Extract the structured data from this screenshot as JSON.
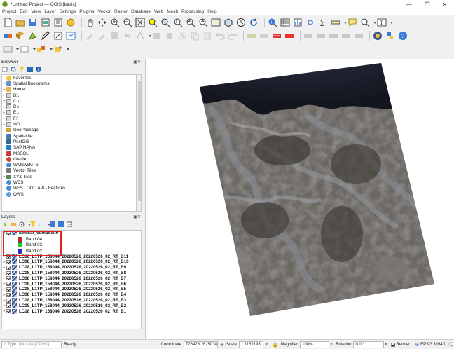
{
  "window": {
    "title": "*Untitled Project — QGIS [basic]",
    "minimize": "—",
    "maximize": "❐",
    "close": "✕"
  },
  "menu": [
    "Project",
    "Edit",
    "View",
    "Layer",
    "Settings",
    "Plugins",
    "Vector",
    "Raster",
    "Database",
    "Web",
    "Mesh",
    "Processing",
    "Help"
  ],
  "browser": {
    "title": "Browser",
    "items": [
      {
        "label": "Favorites",
        "icon": "star-icon",
        "arrow": ""
      },
      {
        "label": "Spatial Bookmarks",
        "icon": "bookmark-icon",
        "arrow": "▸"
      },
      {
        "label": "Home",
        "icon": "home-folder-icon",
        "arrow": "▸"
      },
      {
        "label": "B:\\",
        "icon": "drive-icon",
        "arrow": "▸"
      },
      {
        "label": "C:\\",
        "icon": "drive-icon",
        "arrow": "▸"
      },
      {
        "label": "D:\\",
        "icon": "drive-icon",
        "arrow": "▸"
      },
      {
        "label": "E:\\",
        "icon": "drive-icon",
        "arrow": "▸"
      },
      {
        "label": "F:\\",
        "icon": "drive-icon",
        "arrow": "▸"
      },
      {
        "label": "W:\\",
        "icon": "drive-icon",
        "arrow": "▸"
      },
      {
        "label": "GeoPackage",
        "icon": "geopackage-icon",
        "arrow": ""
      },
      {
        "label": "SpatiaLite",
        "icon": "spatialite-icon",
        "arrow": ""
      },
      {
        "label": "PostGIS",
        "icon": "postgis-icon",
        "arrow": ""
      },
      {
        "label": "SAP HANA",
        "icon": "saphana-icon",
        "arrow": ""
      },
      {
        "label": "MSSQL",
        "icon": "mssql-icon",
        "arrow": ""
      },
      {
        "label": "Oracle",
        "icon": "oracle-icon",
        "arrow": ""
      },
      {
        "label": "WMS/WMTS",
        "icon": "wms-icon",
        "arrow": ""
      },
      {
        "label": "Vector Tiles",
        "icon": "vector-tiles-icon",
        "arrow": ""
      },
      {
        "label": "XYZ Tiles",
        "icon": "xyz-tiles-icon",
        "arrow": "▸"
      },
      {
        "label": "WCS",
        "icon": "wcs-icon",
        "arrow": ""
      },
      {
        "label": "WFS / OGC API - Features",
        "icon": "wfs-icon",
        "arrow": ""
      },
      {
        "label": "OWS",
        "icon": "ows-icon",
        "arrow": ""
      }
    ]
  },
  "layers": {
    "title": "Layers",
    "composite": {
      "name": "landsat_composite",
      "bands": [
        {
          "label": "Band 04",
          "color": "#e31a1c"
        },
        {
          "label": "Band 03",
          "color": "#1bd11b"
        },
        {
          "label": "Band 02",
          "color": "#1a2fe0"
        }
      ]
    },
    "items": [
      "LC08_L1TP_158044_20220526_20220526_02_RT_B11",
      "LC08_L1TP_158044_20220526_20220526_02_RT_B10",
      "LC08_L1TP_158044_20220526_20220526_02_RT_B9",
      "LC08_L1TP_158044_20220526_20220526_02_RT_B8",
      "LC08_L1TP_158044_20220526_20220526_02_RT_B7",
      "LC08_L1TP_158044_20220526_20220526_02_RT_B6",
      "LC08_L1TP_158044_20220526_20220526_02_RT_B5",
      "LC08_L1TP_158044_20220526_20220526_02_RT_B4",
      "LC08_L1TP_158044_20220526_20220526_02_RT_B3",
      "LC08_L1TP_158044_20220526_20220526_02_RT_B2",
      "LC08_L1TP_158044_20220526_20220526_02_RT_B1"
    ]
  },
  "status": {
    "locator_placeholder": "Type to locate (Ctrl+K)",
    "ready": "Ready",
    "coordinate_label": "Coordinate",
    "coordinate_value": "728426,2625038",
    "scale_label": "Scale",
    "scale_value": "1:1162198",
    "magnifier_label": "Magnifier",
    "magnifier_value": "100%",
    "rotation_label": "Rotation",
    "rotation_value": "0.0 °",
    "render_label": "Render",
    "crs": "EPSG:32640"
  },
  "colors": {
    "highlight": "#e31e24",
    "sea": "#1f2230",
    "land": "#6e6a66"
  }
}
